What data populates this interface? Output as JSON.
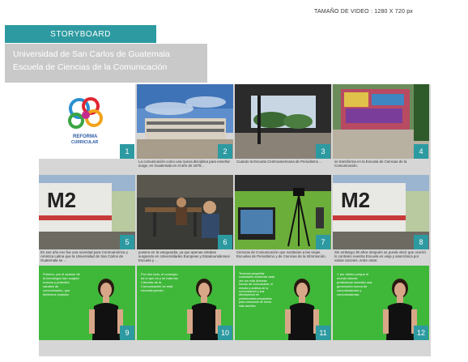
{
  "video_size": "TAMAÑO DE VIDEO : 1280 X 720 px",
  "tab_label": "STORYBOARD",
  "header": {
    "line1": "Universidad de San Carlos de Guatemala",
    "line2": "Escuela de Ciencias de la Comunicación"
  },
  "logo_text": {
    "line1": "REFORMA",
    "line2": "CURRICULAR"
  },
  "frames": [
    {
      "number": "1",
      "caption": ""
    },
    {
      "number": "2",
      "caption": "La comunicación como una nueva disciplina para enseñar surge, en Guatemala en el año de 1978..."
    },
    {
      "number": "3",
      "caption": "Cuando la Escuela Centroamericana de Periodismo ..."
    },
    {
      "number": "4",
      "caption": "se transforma en la Escuela de Ciencias de la Comunicación."
    },
    {
      "number": "5",
      "caption": "En ese año eso fue una novedad para Centroamérica y América Latina que la Universidad de San Carlos de Guatemala se ..."
    },
    {
      "number": "6",
      "caption": "pusiera en la vanguardia, ya que apenas estaban surgiendo en Universidades Europeas y Estadounidenses Escuela y ..."
    },
    {
      "number": "7",
      "caption": "Ciencias de Comunicación que sustituían a las viejas Escuelas de Periodismo y de Ciencias de la Información."
    },
    {
      "number": "8",
      "caption": "Sin embargo 35 años después se puede decir que ocurrió lo contrario nuestra Escuela es vieja y anacrónica por varias razones, entre otras:"
    },
    {
      "number": "9",
      "overlay": "Primero, por el avance de la tecnología han surgido nuevos y potentes canales de comunicación, que debemos explotar."
    },
    {
      "number": "10",
      "overlay": "Por otro lado, el concepto de lo que es y se trata las Ciencias de la Comunicación se está reconstruyendo."
    },
    {
      "number": "11",
      "overlay": "Tenemos pequeñas sociedades modernas cada vez con más diversas formas de comunicarse, el estudio y análisis de la comunicación y sus afectaciones en profesionales preparados para comunicar de forma más asertiva."
    },
    {
      "number": "12",
      "overlay": "Y por último porque el mundo laboral profesional necesita una generación nueva de comunicadores y comunicadoras."
    }
  ],
  "colors": {
    "accent": "#2d9aa1",
    "header_gray": "#c9c9c9",
    "board_gray": "#d6d6d6",
    "green_screen": "#3fb83a"
  }
}
